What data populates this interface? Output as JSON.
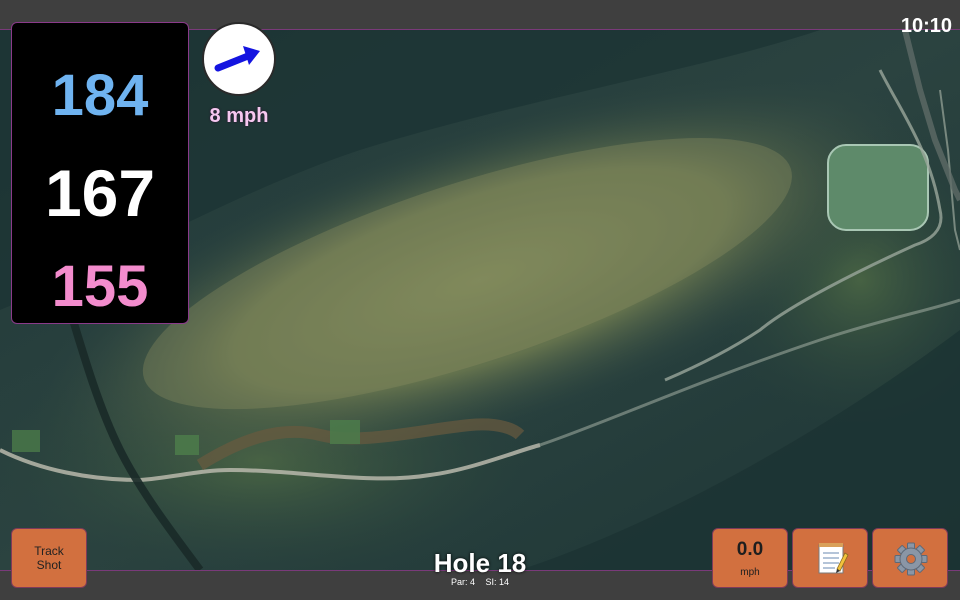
{
  "status": {
    "time": "10:10"
  },
  "distances": {
    "back": "184",
    "middle": "167",
    "front": "155"
  },
  "wind": {
    "speed": "8 mph",
    "direction_icon": "arrow-icon",
    "arrow_color": "#1414e0"
  },
  "hole": {
    "title": "Hole 18",
    "par": "Par: 4",
    "stroke_index": "SI: 14"
  },
  "buttons": {
    "track_shot_line1": "Track",
    "track_shot_line2": "Shot",
    "speed_value": "0.0",
    "speed_unit": "mph",
    "notes_icon": "notepad-icon",
    "settings_icon": "gear-icon"
  },
  "colors": {
    "back_distance": "#6fb3f0",
    "middle_distance": "#ffffff",
    "front_distance": "#f38ccd",
    "button": "#d2703f",
    "accent_border": "#8a3a8a"
  }
}
